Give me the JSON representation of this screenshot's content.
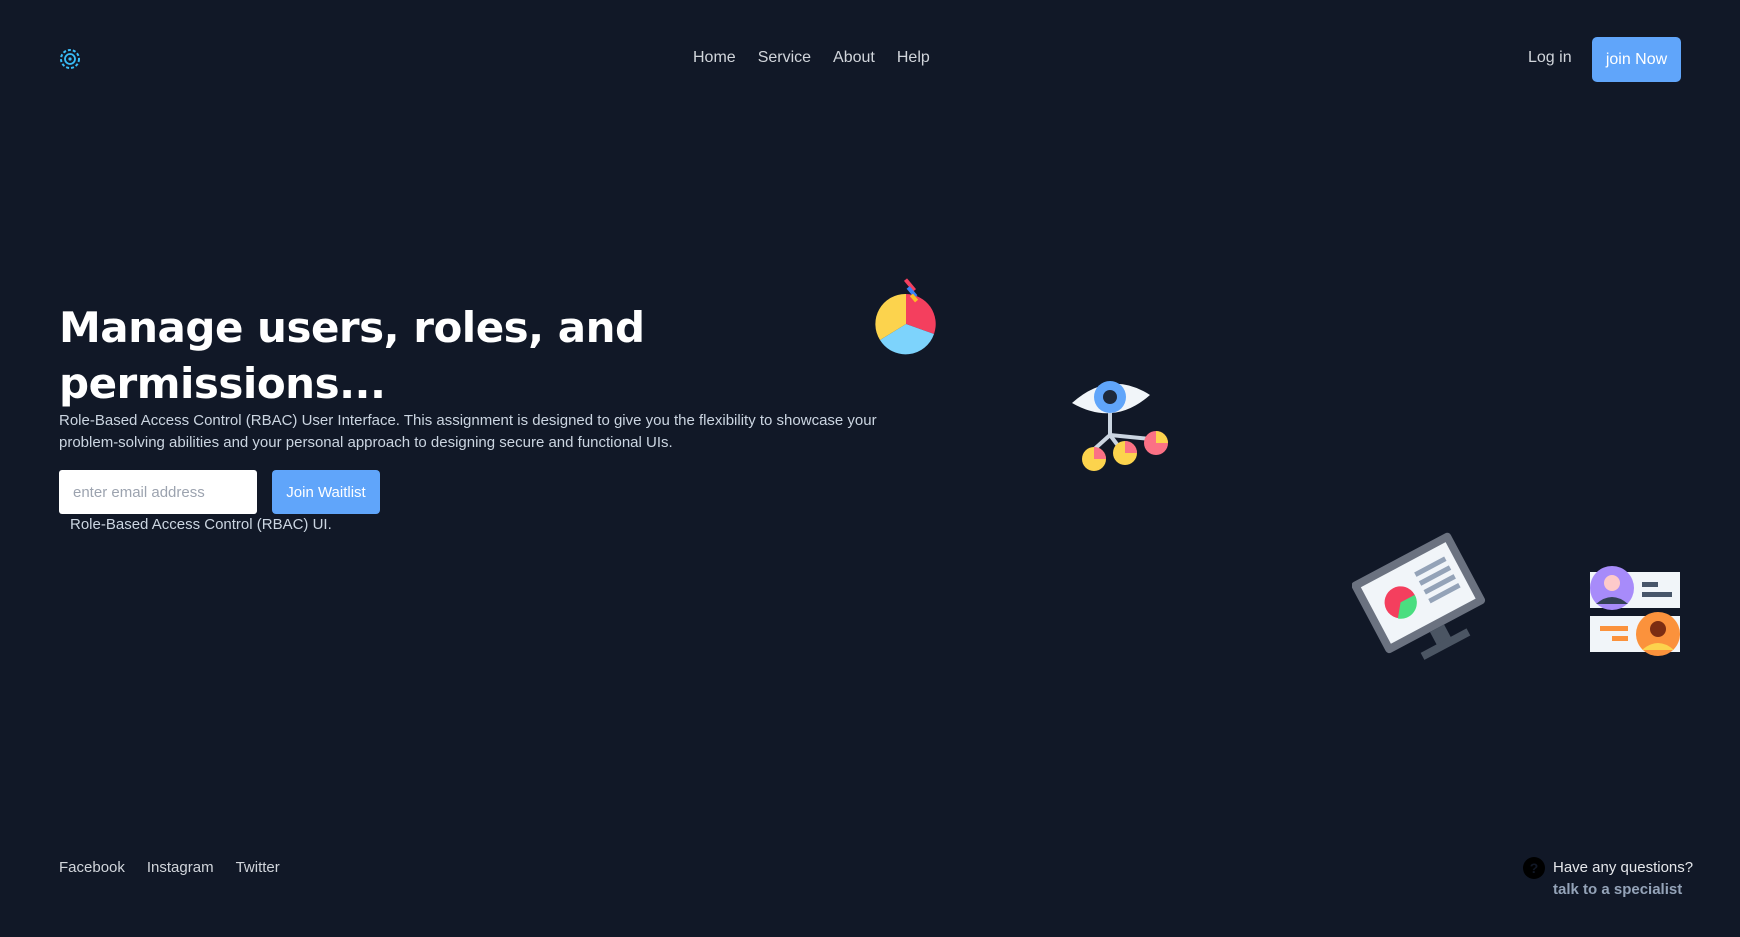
{
  "header": {
    "nav": [
      "Home",
      "Service",
      "About",
      "Help"
    ],
    "login_label": "Log in",
    "join_label": "join Now"
  },
  "hero": {
    "title": "Manage users, roles, and permissions...",
    "description": "Role-Based Access Control (RBAC) User Interface. This assignment is designed to give you the flexibility to showcase your problem-solving abilities and your personal approach to designing secure and functional UIs.",
    "email_placeholder": "enter email address",
    "email_value": "",
    "waitlist_label": "Join Waitlist",
    "note": "Role-Based Access Control (RBAC) UI."
  },
  "footer": {
    "links": [
      "Facebook",
      "Instagram",
      "Twitter"
    ],
    "help_question": "Have any questions?",
    "help_link": "talk to a specialist"
  },
  "icons": {
    "logo": "atom-gear-icon",
    "illustrations": [
      "pie-chart-icon",
      "eye-network-icon",
      "monitor-chart-icon",
      "user-cards-icon",
      "help-icon"
    ]
  },
  "colors": {
    "background": "#111827",
    "accent": "#60a5fa",
    "text": "#e5e7eb"
  }
}
